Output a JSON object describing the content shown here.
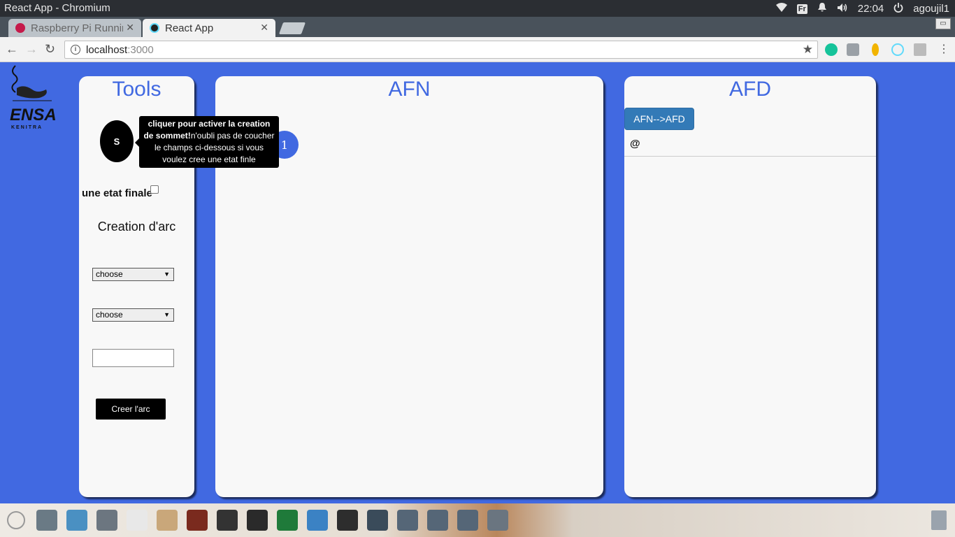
{
  "window": {
    "title": "React App - Chromium"
  },
  "tray": {
    "keyboard": "Fr",
    "time": "22:04",
    "user": "agoujil1"
  },
  "tabs": [
    {
      "label": "Raspberry Pi Runnin",
      "favicon_color": "#c51a4a"
    },
    {
      "label": "React App",
      "favicon_color": "#61dafb"
    }
  ],
  "address": {
    "host": "localhost",
    "port": ":3000"
  },
  "tools": {
    "title": "Tools",
    "sommet_label": "S",
    "final_label": "une etat finale",
    "arc_title": "Creation d'arc",
    "select1": "choose",
    "select2": "choose",
    "create_label": "Creer l'arc"
  },
  "tooltip": {
    "bold": "cliquer pour activer la creation de sommet!",
    "text": "n'oubli pas de coucher le champs ci-dessous si vous voulez cree une etat finle"
  },
  "afn": {
    "title": "AFN",
    "node_label": "1"
  },
  "afd": {
    "title": "AFD",
    "button_label": "AFN-->AFD",
    "row": "@"
  },
  "taskbar": {
    "icons": [
      "files-icon",
      "software-store-icon",
      "settings-icon",
      "text-editor-icon",
      "archive-icon",
      "book-icon",
      "inkscape-icon",
      "chess-icon",
      "system-monitor-icon",
      "chromium-icon",
      "sublime-text-icon",
      "terminal-icon",
      "disk-icon",
      "disk-icon",
      "disk-icon",
      "server-icon"
    ],
    "colors": [
      "#6a7a85",
      "#4a90c2",
      "#6c7680",
      "#e8e8e8",
      "#c9a77a",
      "#7a2a1e",
      "#333333",
      "#2a2a2a",
      "#1f7a3a",
      "#3b82c4",
      "#2d2d2d",
      "#3a4b5a",
      "#556677",
      "#556677",
      "#556677",
      "#6a7580"
    ]
  }
}
